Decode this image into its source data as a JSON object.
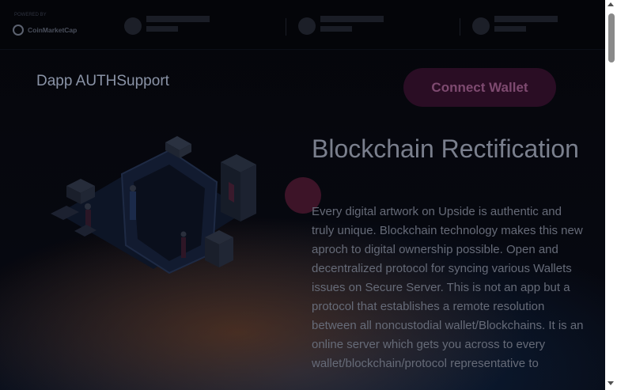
{
  "ticker": {
    "powered_by": "POWERED BY",
    "logo_text": "CoinMarketCap",
    "coins": [
      {},
      {},
      {}
    ]
  },
  "header": {
    "brand": "Dapp AUTHSupport",
    "connect_label": "Connect Wallet"
  },
  "hero": {
    "title": "Blockchain Rectification",
    "body": "Every digital artwork on Upside is authentic and truly unique. Blockchain technology makes this new aproch to digital ownership possible. Open and decentralized protocol for syncing various Wallets issues on Secure Server. This is not an app but a protocol that establishes a remote resolution between all noncustodial wallet/Blockchains. It is an online server which gets you across to every wallet/blockchain/protocol representative to"
  },
  "colors": {
    "background": "#06070d",
    "accent": "#3d1428",
    "button": "#2a0d24"
  }
}
